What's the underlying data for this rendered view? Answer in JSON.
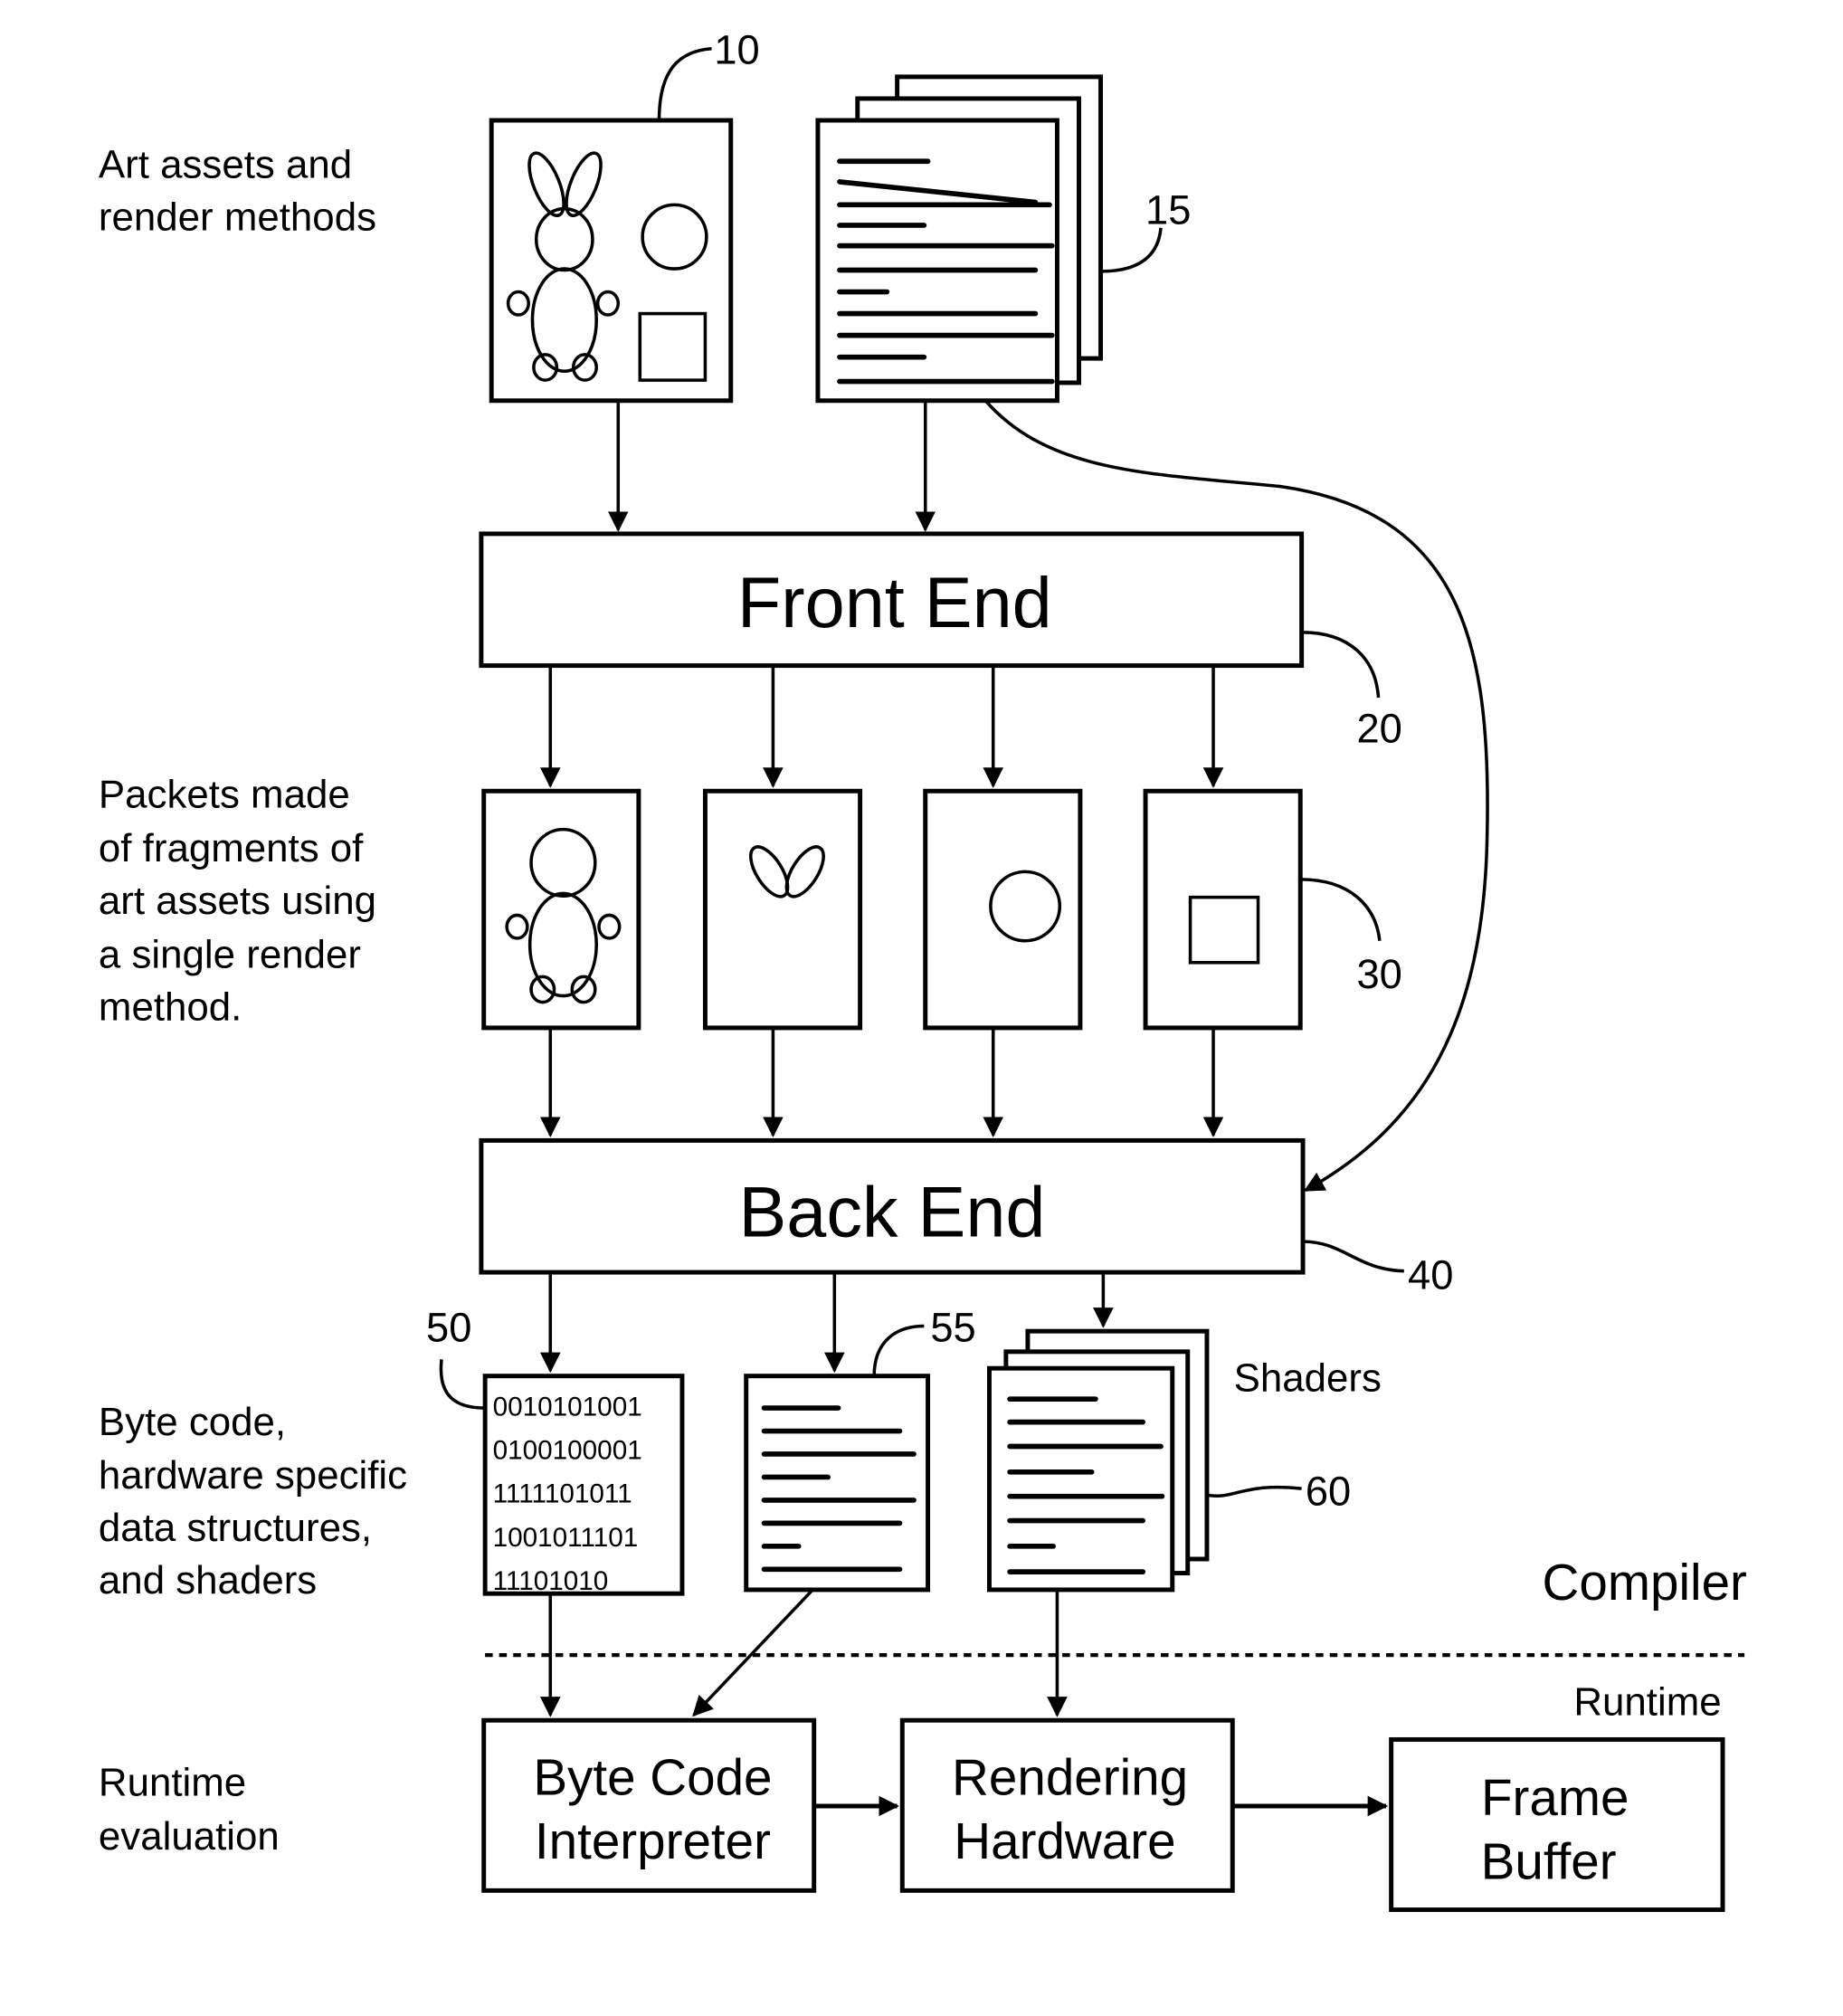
{
  "side_labels": {
    "art_assets": [
      "Art assets and",
      "render methods"
    ],
    "packets": [
      "Packets made",
      "of fragments of",
      "art assets using",
      "a single render",
      "method."
    ],
    "byte_code": [
      "Byte code,",
      "hardware specific",
      "data structures,",
      "and shaders"
    ],
    "runtime_eval": [
      "Runtime",
      "evaluation"
    ]
  },
  "blocks": {
    "front_end": "Front End",
    "back_end": "Back End",
    "byte_code_interpreter": [
      "Byte Code",
      "Interpreter"
    ],
    "rendering_hardware": [
      "Rendering",
      "Hardware"
    ],
    "frame_buffer": [
      "Frame",
      "Buffer"
    ]
  },
  "reference_numerals": {
    "art_asset_sheet": "10",
    "render_methods_stack": "15",
    "front_end": "20",
    "packets": "30",
    "back_end": "40",
    "byte_code": "50",
    "data_structures": "55",
    "shaders": "60"
  },
  "byte_code_lines": [
    "0010101001",
    "0100100001",
    "1111101011",
    "1001011101",
    "11101010"
  ],
  "labels": {
    "shaders": "Shaders",
    "compiler": "Compiler",
    "runtime": "Runtime"
  }
}
